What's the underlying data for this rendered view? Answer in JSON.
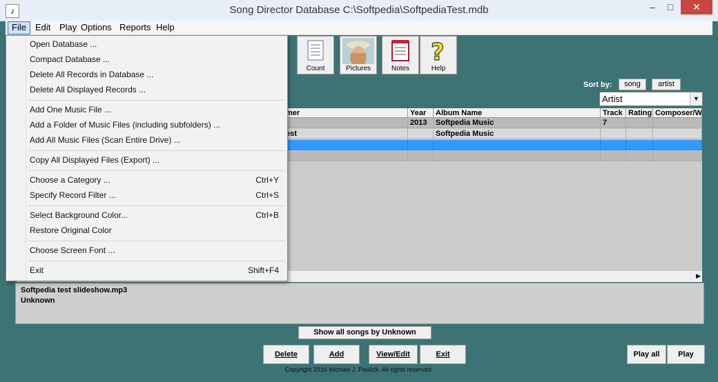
{
  "window": {
    "title": "Song Director Database  C:\\Softpedia\\SoftpediaTest.mdb",
    "icon": "music-note-icon",
    "minimize": "–",
    "maximize": "□",
    "close": "✕"
  },
  "menubar": [
    "File",
    "Edit",
    "Play",
    "Options",
    "Reports",
    "Help"
  ],
  "toolbar": {
    "count": "Count",
    "pictures": "Pictures",
    "notes": "Notes",
    "help": "Help"
  },
  "sort": {
    "label": "Sort by:",
    "song": "song",
    "artist": "artist",
    "selected": "Artist"
  },
  "grid": {
    "headers": [
      "mer",
      "Year",
      "Album Name",
      "Track",
      "Rating",
      "Composer/Wri"
    ],
    "rows": [
      [
        "",
        "2013",
        "Softpedia Music",
        "7",
        "",
        ""
      ],
      [
        "est",
        "",
        "Softpedia Music",
        "",
        "",
        ""
      ],
      [
        "",
        "",
        "",
        "",
        "",
        ""
      ],
      [
        "",
        "",
        "",
        "",
        "",
        ""
      ]
    ]
  },
  "info": {
    "line1": "Softpedia test slideshow.mp3",
    "line2": "Unknown"
  },
  "buttons": {
    "show_all": "Show all songs by Unknown",
    "delete": "Delete",
    "add": "Add",
    "view_edit": "View/Edit",
    "exit": "Exit",
    "play_all": "Play all",
    "play": "Play"
  },
  "copyright": "Copyright 2016 Michael J. Paulick.  All rights reserved.",
  "file_menu": {
    "open_database": "Open Database ...",
    "compact_database": "Compact Database ...",
    "delete_all_records": "Delete All Records in Database ...",
    "delete_displayed_records": "Delete All Displayed Records ...",
    "add_one_file": "Add One Music File ...",
    "add_folder": "Add a Folder of Music Files (including subfolders) ...",
    "add_all_files": "Add All Music Files (Scan Entire Drive) ...",
    "copy_displayed": "Copy All Displayed Files (Export) ...",
    "choose_category": "Choose a Category ...",
    "choose_category_shortcut": "Ctrl+Y",
    "specify_filter": "Specify Record Filter ...",
    "specify_filter_shortcut": "Ctrl+S",
    "select_bg_color": "Select Background Color...",
    "select_bg_color_shortcut": "Ctrl+B",
    "restore_color": "Restore Original Color",
    "choose_font": "Choose Screen Font ...",
    "exit": "Exit",
    "exit_shortcut": "Shift+F4"
  }
}
